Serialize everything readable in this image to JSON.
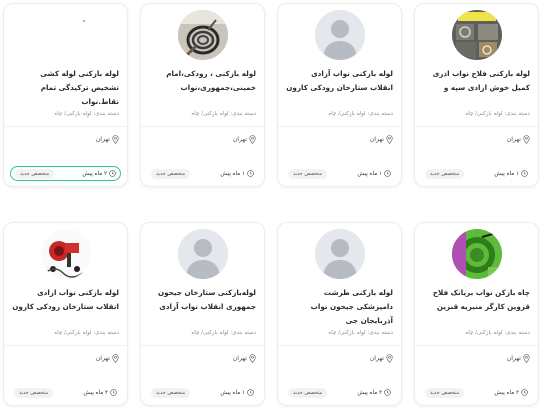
{
  "listings": [
    {
      "title": "لوله بازکنی لوله کشی تشخیص ترکیدگی تمام نقاط.نواب",
      "category": "دسته بندی: لوله بازکنی/ چاه",
      "city": "تهران",
      "time": "۲ ماه پیش",
      "badge": "متخصص جدید",
      "avatar": "none",
      "marker": "\""
    },
    {
      "title": "لوله بازکنی ، رودکی،امام خمینی،جمهوری،نواب",
      "category": "دسته بندی: لوله بازکنی/ چاه",
      "city": "تهران",
      "time": "۱ ماه پیش",
      "badge": "متخصص جدید",
      "avatar": "photo-cables"
    },
    {
      "title": "لوله بازکنی نواب آزادی انقلاب ستارخان رودکی کارون",
      "category": "دسته بندی: لوله بازکنی/ چاه",
      "city": "تهران",
      "time": "۱ ماه پیش",
      "badge": "متخصص جدید",
      "avatar": "placeholder"
    },
    {
      "title": "لوله بازکنی فلاح نواب اذری کمیل خوش ازادی سپه و",
      "category": "دسته بندی: لوله بازکنی/ چاه",
      "city": "تهران",
      "time": "۱ ماه پیش",
      "badge": "متخصص جدید",
      "avatar": "photo-tools"
    },
    {
      "title": "لوله بازکنی نواب ازادی انقلاب ستارخان رودکی کارون",
      "category": "دسته بندی: لوله بازکنی/ چاه",
      "city": "تهران",
      "time": "۳ ماه پیش",
      "badge": "متخصص جدید",
      "avatar": "photo-machine"
    },
    {
      "title": "لوله‌بازکنی ستارخان جیحون جمهوری انقلاب نواب آزادی",
      "category": "دسته بندی: لوله بازکنی/ چاه",
      "city": "تهران",
      "time": "۱ ماه پیش",
      "badge": "متخصص جدید",
      "avatar": "placeholder"
    },
    {
      "title": "لوله بازکنی طرشت دامپزشکی جیحون نواب آذربایجان جی",
      "category": "دسته بندی: لوله بازکنی/ چاه",
      "city": "تهران",
      "time": "۳ ماه پیش",
      "badge": "متخصص جدید",
      "avatar": "placeholder"
    },
    {
      "title": "چاه بازکن نواب بریانک فلاح قزوین کارگر منیریه قنزین",
      "category": "دسته بندی: لوله بازکنی/ چاه",
      "city": "تهران",
      "time": "۲ ماه پیش",
      "badge": "متخصص جدید",
      "avatar": "photo-green"
    }
  ],
  "colors": {
    "highlight_border": "#2ec4a0",
    "badge_bg": "#f2f2f2",
    "placeholder_bg": "#e4e7ec",
    "placeholder_fg": "#b7bcc4"
  }
}
